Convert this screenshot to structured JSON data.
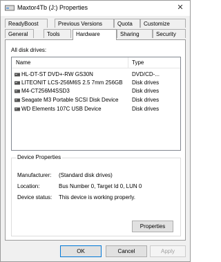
{
  "window": {
    "title": "Maxtor4Tb (J:) Properties",
    "close_glyph": "✕"
  },
  "tabs": {
    "row1": [
      "ReadyBoost",
      "Previous Versions",
      "Quota",
      "Customize"
    ],
    "row2": [
      "General",
      "Tools",
      "Hardware",
      "Sharing",
      "Security"
    ],
    "active": "Hardware"
  },
  "hardware": {
    "all_disk_drives_label": "All disk drives:",
    "columns": {
      "name": "Name",
      "type": "Type"
    },
    "drives": [
      {
        "name": "HL-DT-ST DVD+-RW GS30N",
        "type": "DVD/CD-...",
        "icon": "optical-drive-icon"
      },
      {
        "name": "LITEONIT LCS-256M6S 2.5 7mm 256GB",
        "type": "Disk drives",
        "icon": "disk-drive-icon"
      },
      {
        "name": "M4-CT256M4SSD3",
        "type": "Disk drives",
        "icon": "disk-drive-icon"
      },
      {
        "name": "Seagate M3 Portable SCSI Disk Device",
        "type": "Disk drives",
        "icon": "disk-drive-icon"
      },
      {
        "name": "WD Elements 107C USB Device",
        "type": "Disk drives",
        "icon": "disk-drive-icon"
      }
    ],
    "selected_index": 3,
    "device_properties": {
      "title": "Device Properties",
      "manufacturer_label": "Manufacturer:",
      "manufacturer_value": "(Standard disk drives)",
      "location_label": "Location:",
      "location_value": "Bus Number 0, Target Id 0, LUN 0",
      "status_label": "Device status:",
      "status_value": "This device is working properly."
    },
    "properties_button": "Properties"
  },
  "footer": {
    "ok": "OK",
    "cancel": "Cancel",
    "apply": "Apply"
  },
  "colors": {
    "annotation_red": "#d03030",
    "focus_blue": "#0078d7"
  }
}
